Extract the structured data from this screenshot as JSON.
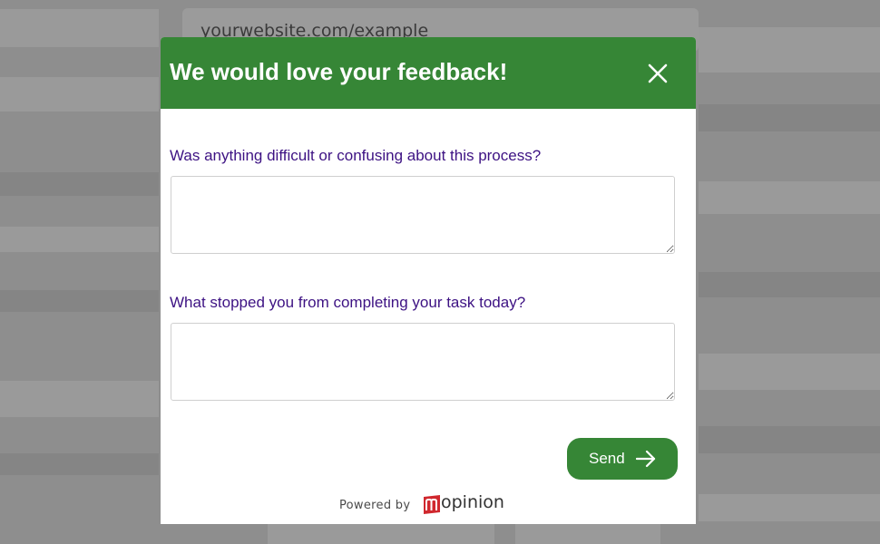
{
  "background": {
    "url_text": "yourwebsite.com/example"
  },
  "modal": {
    "title": "We would love your feedback!",
    "close_icon": "close-icon",
    "questions": [
      {
        "label": "Was anything difficult or confusing about this process?",
        "value": ""
      },
      {
        "label": "What stopped you from completing your task today?",
        "value": ""
      }
    ],
    "send_label": "Send",
    "send_icon": "arrow-right-icon",
    "powered_by": "Powered by",
    "brand_name": "opinion"
  },
  "colors": {
    "header_green": "#368636",
    "question_purple": "#3d1283",
    "brand_red": "#d0282e",
    "overlay_gray": "#8e8e8e"
  }
}
